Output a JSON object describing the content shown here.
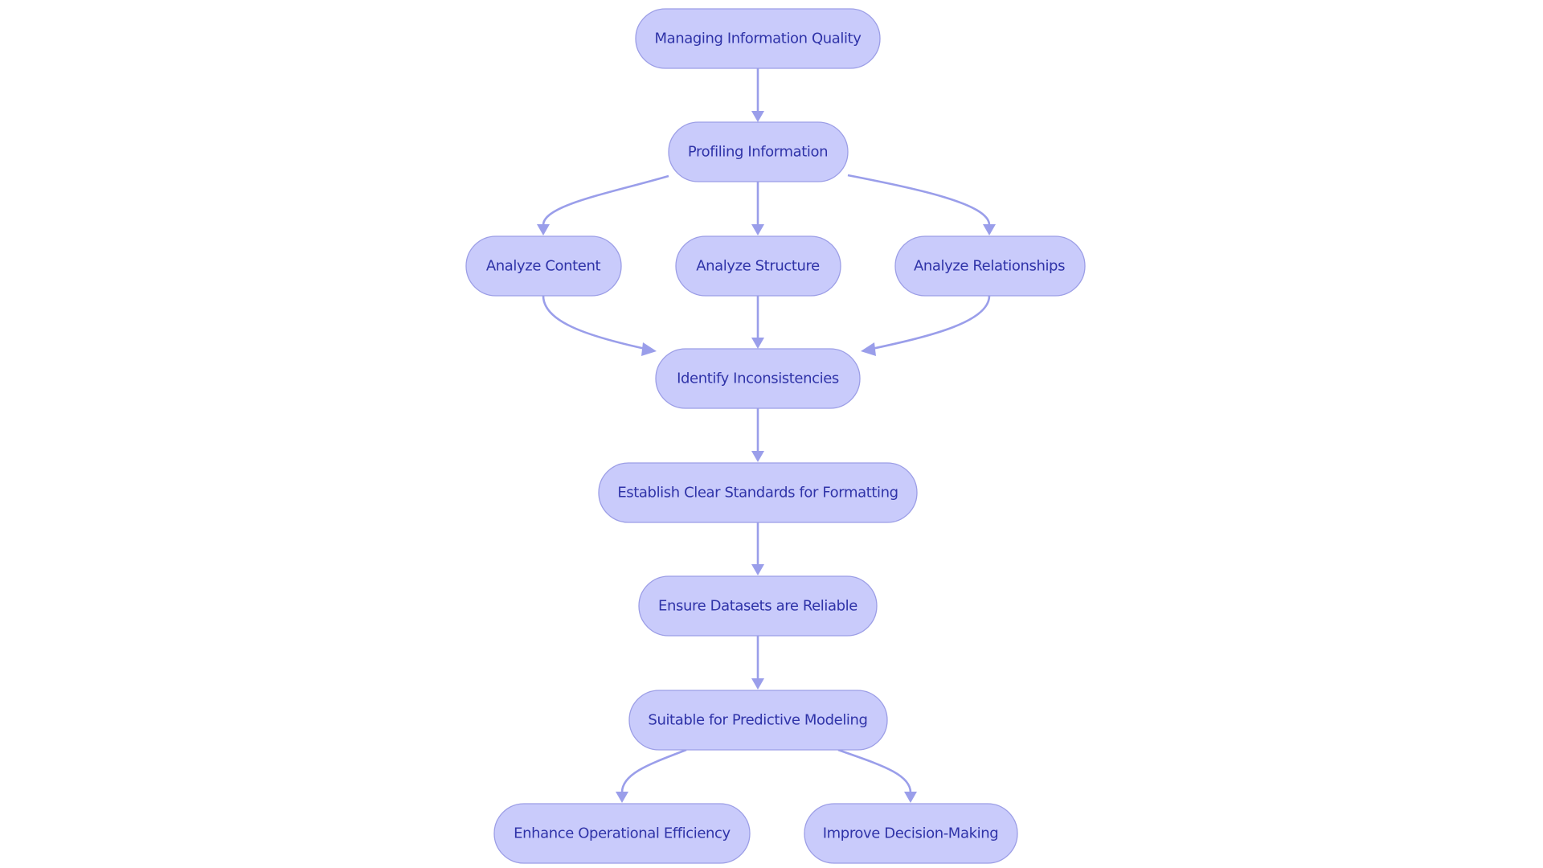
{
  "diagram": {
    "type": "flowchart",
    "direction": "top-down",
    "colors": {
      "node_fill": "#c9cbfb",
      "node_stroke": "#9c9ee6",
      "node_text": "#2f33a8",
      "edge": "#9a9eea",
      "background": "#ffffff"
    },
    "nodes": [
      {
        "id": "n1",
        "label": "Managing Information Quality"
      },
      {
        "id": "n2",
        "label": "Profiling Information"
      },
      {
        "id": "n3",
        "label": "Analyze Content"
      },
      {
        "id": "n4",
        "label": "Analyze Structure"
      },
      {
        "id": "n5",
        "label": "Analyze Relationships"
      },
      {
        "id": "n6",
        "label": "Identify Inconsistencies"
      },
      {
        "id": "n7",
        "label": "Establish Clear Standards for Formatting"
      },
      {
        "id": "n8",
        "label": "Ensure Datasets are Reliable"
      },
      {
        "id": "n9",
        "label": "Suitable for Predictive Modeling"
      },
      {
        "id": "n10",
        "label": "Enhance Operational Efficiency"
      },
      {
        "id": "n11",
        "label": "Improve Decision-Making"
      }
    ],
    "edges": [
      {
        "from": "n1",
        "to": "n2"
      },
      {
        "from": "n2",
        "to": "n3"
      },
      {
        "from": "n2",
        "to": "n4"
      },
      {
        "from": "n2",
        "to": "n5"
      },
      {
        "from": "n3",
        "to": "n6"
      },
      {
        "from": "n4",
        "to": "n6"
      },
      {
        "from": "n5",
        "to": "n6"
      },
      {
        "from": "n6",
        "to": "n7"
      },
      {
        "from": "n7",
        "to": "n8"
      },
      {
        "from": "n8",
        "to": "n9"
      },
      {
        "from": "n9",
        "to": "n10"
      },
      {
        "from": "n9",
        "to": "n11"
      }
    ]
  }
}
